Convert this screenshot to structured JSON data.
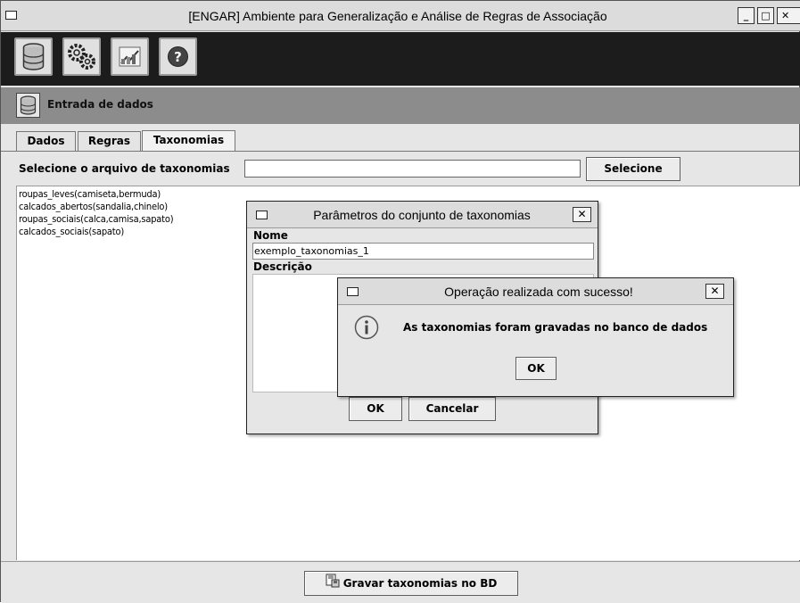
{
  "window": {
    "title": "[ENGAR] Ambiente para Generalização e Análise de Regras de Associação",
    "controls": [
      "_",
      "□",
      "✕"
    ]
  },
  "toolbar": {
    "buttons": [
      {
        "icon": "database-icon"
      },
      {
        "icon": "gears-icon"
      },
      {
        "icon": "chart-icon"
      },
      {
        "icon": "help-icon"
      }
    ]
  },
  "section": {
    "title": "Entrada de dados",
    "icon": "database-icon"
  },
  "tabs": [
    {
      "label": "Dados",
      "active": false
    },
    {
      "label": "Regras",
      "active": false
    },
    {
      "label": "Taxonomias",
      "active": true
    }
  ],
  "file_select": {
    "label": "Selecione o arquivo de taxonomias",
    "value": "",
    "button_label": "Selecione"
  },
  "taxonomy_lines": [
    "roupas_leves(camiseta,bermuda)",
    "calcados_abertos(sandalia,chinelo)",
    "roupas_sociais(calca,camisa,sapato)",
    "calcados_sociais(sapato)"
  ],
  "save_button": {
    "label": "Gravar taxonomias no BD",
    "icon": "save-db-icon"
  },
  "params_dialog": {
    "title": "Parâmetros do conjunto de taxonomias",
    "name_label": "Nome",
    "name_value": "exemplo_taxonomias_1",
    "description_label": "Descrição",
    "description_value": "",
    "ok_label": "OK",
    "cancel_label": "Cancelar"
  },
  "message_dialog": {
    "title": "Operação realizada com sucesso!",
    "message": "As taxonomias foram gravadas no banco de dados",
    "ok_label": "OK",
    "icon": "info-icon"
  }
}
